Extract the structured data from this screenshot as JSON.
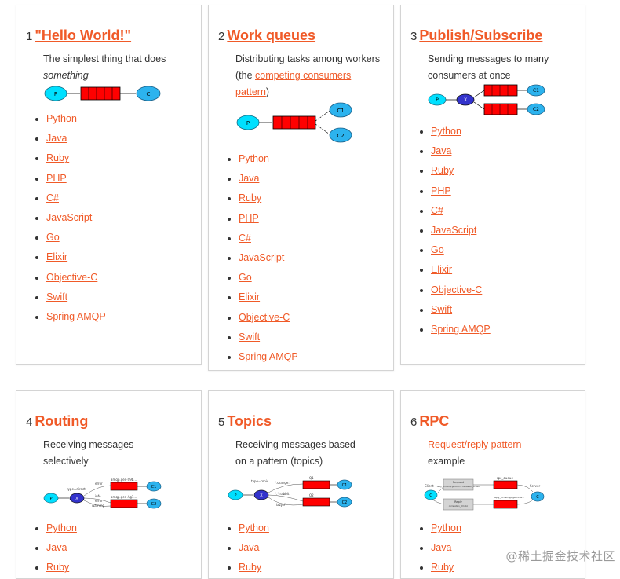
{
  "tutorials": [
    {
      "number": "1",
      "title": "\"Hello World!\"",
      "description": {
        "text": "The simplest thing that does",
        "em": "something"
      },
      "languages": [
        "Python",
        "Java",
        "Ruby",
        "PHP",
        "C#",
        "JavaScript",
        "Go",
        "Elixir",
        "Objective-C",
        "Swift",
        "Spring AMQP"
      ]
    },
    {
      "number": "2",
      "title": "Work queues",
      "description": {
        "before": "Distributing tasks among workers (the ",
        "link": "competing consumers pattern",
        "after": ")"
      },
      "languages": [
        "Python",
        "Java",
        "Ruby",
        "PHP",
        "C#",
        "JavaScript",
        "Go",
        "Elixir",
        "Objective-C",
        "Swift",
        "Spring AMQP"
      ]
    },
    {
      "number": "3",
      "title": "Publish/Subscribe",
      "description": {
        "text": "Sending messages to many consumers at once"
      },
      "languages": [
        "Python",
        "Java",
        "Ruby",
        "PHP",
        "C#",
        "JavaScript",
        "Go",
        "Elixir",
        "Objective-C",
        "Swift",
        "Spring AMQP"
      ]
    },
    {
      "number": "4",
      "title": "Routing",
      "description": {
        "text": "Receiving messages selectively"
      },
      "languages": [
        "Python",
        "Java",
        "Ruby"
      ]
    },
    {
      "number": "5",
      "title": "Topics",
      "description": {
        "text": "Receiving messages based on a pattern (topics)"
      },
      "languages": [
        "Python",
        "Java",
        "Ruby"
      ]
    },
    {
      "number": "6",
      "title": "RPC",
      "description": {
        "link": "Request/reply pattern",
        "after": "example"
      },
      "languages": [
        "Python",
        "Java",
        "Ruby"
      ]
    }
  ],
  "diagram_labels": {
    "producer": "P",
    "consumer": "C",
    "c1": "C1",
    "c2": "C2",
    "exchange": "X",
    "q1": "Q1",
    "q2": "Q2",
    "routing_error": "error",
    "routing_info": "info",
    "routing_warning": "warning",
    "routing_type": "type=direct",
    "queue_a": "amqp.gen-S9b...",
    "queue_b": "amqp.gen-Ag1...",
    "topic_type": "type=topic",
    "topic_orange": "*.orange.*",
    "topic_rabbit": "*.*.rabbit",
    "topic_lazy": "lazy.#",
    "rpc_client": "Client",
    "rpc_server": "Server",
    "rpc_queue": "rpc_queue",
    "rpc_request": "Request",
    "rpc_request_props": "reply_to=amqp.gen-Xa2... correlation_id=abc",
    "rpc_reply": "Reply",
    "rpc_reply_props": "correlation_id=abc",
    "rpc_reply_to": "reply_to=amqp.gen-Xa2..."
  },
  "colors": {
    "accent": "#f05a28",
    "queue_red": "#ff0000",
    "node_cyan": "#00e0ff",
    "consumer_blue": "#2cb3ee",
    "exchange_blue": "#3333cc"
  },
  "watermark": "@稀土掘金技术社区"
}
